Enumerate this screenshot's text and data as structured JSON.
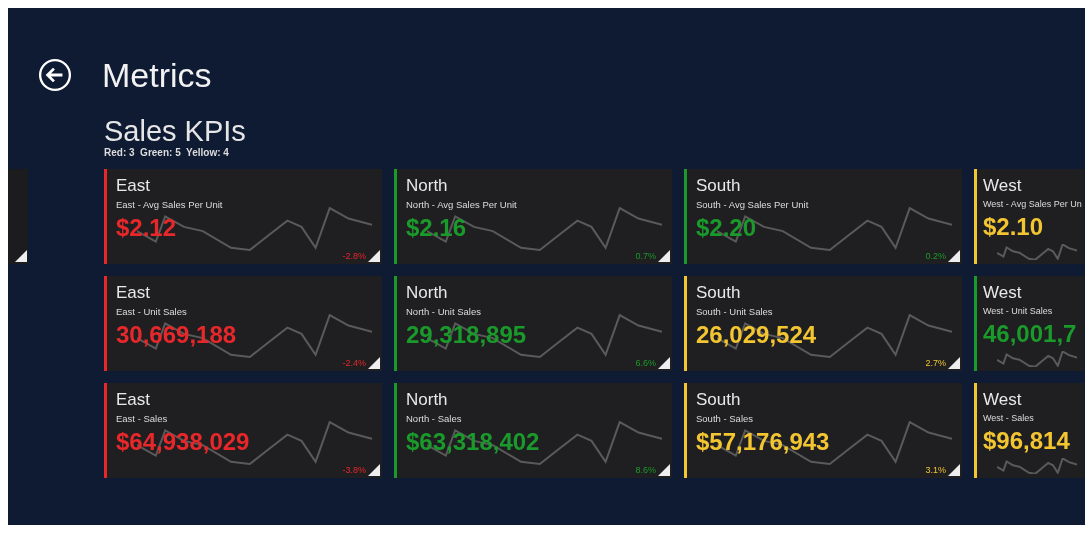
{
  "header": {
    "title": "Metrics"
  },
  "section": {
    "title": "Sales KPIs",
    "summary": "Red: 3  Green: 5  Yellow: 4"
  },
  "tile_rows": [
    [
      {
        "region": "East",
        "measure": "East - Avg Sales Per Unit",
        "value": "$2.12",
        "change": "-2.8%",
        "color": "#e8272a"
      },
      {
        "region": "North",
        "measure": "North - Avg Sales Per Unit",
        "value": "$2.16",
        "change": "0.7%",
        "color": "#1a9a2a"
      },
      {
        "region": "South",
        "measure": "South - Avg Sales Per Unit",
        "value": "$2.20",
        "change": "0.2%",
        "color": "#1a9a2a"
      },
      {
        "region": "West",
        "measure": "West - Avg Sales Per Un",
        "value": "$2.10",
        "color": "#f2c531"
      }
    ],
    [
      {
        "region": "East",
        "measure": "East - Unit Sales",
        "value": "30,669,188",
        "change": "-2.4%",
        "color": "#e8272a"
      },
      {
        "region": "North",
        "measure": "North - Unit Sales",
        "value": "29,318,895",
        "change": "6.6%",
        "color": "#1a9a2a"
      },
      {
        "region": "South",
        "measure": "South - Unit Sales",
        "value": "26,029,524",
        "change": "2.7%",
        "color": "#f2c531"
      },
      {
        "region": "West",
        "measure": "West - Unit Sales",
        "value": "46,001,7",
        "color": "#1a9a2a"
      }
    ],
    [
      {
        "region": "East",
        "measure": "East - Sales",
        "value": "$64,938,029",
        "change": "-3.8%",
        "color": "#e8272a"
      },
      {
        "region": "North",
        "measure": "North - Sales",
        "value": "$63,318,402",
        "change": "8.6%",
        "color": "#1a9a2a"
      },
      {
        "region": "South",
        "measure": "South - Sales",
        "value": "$57,176,943",
        "change": "3.1%",
        "color": "#f2c531"
      },
      {
        "region": "West",
        "measure": "West - Sales",
        "value": "$96,814",
        "color": "#f2c531"
      }
    ]
  ]
}
